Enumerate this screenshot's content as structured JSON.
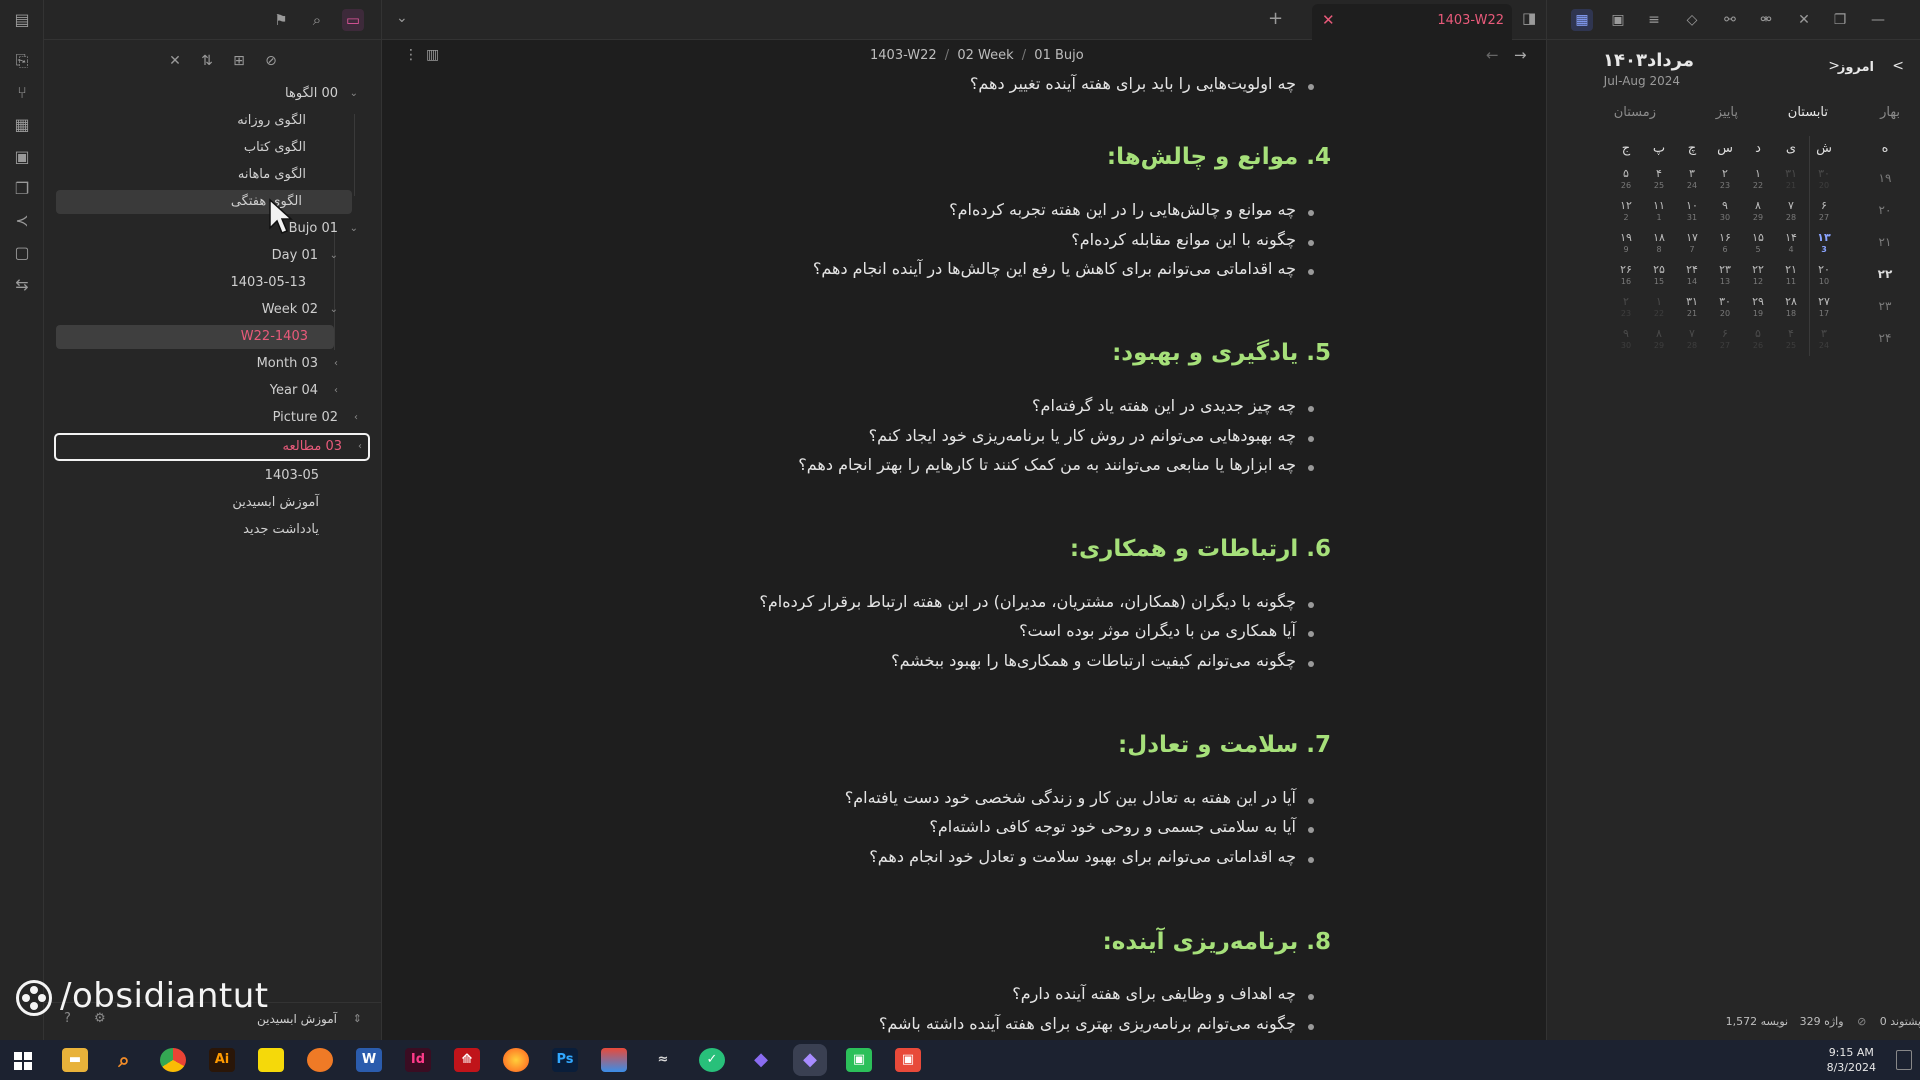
{
  "sidebar": {
    "tree": [
      {
        "label": "00 الگوها",
        "expanded": true
      },
      {
        "label": "الگوی روزانه"
      },
      {
        "label": "الگوی کتاب"
      },
      {
        "label": "الگوی ماهانه"
      },
      {
        "label": "الگوی هفتگی"
      },
      {
        "label": "01 Bujo",
        "expanded": true
      },
      {
        "label": "01 Day",
        "expanded": true
      },
      {
        "label": "1403-05-13"
      },
      {
        "label": "02 Week",
        "expanded": true
      },
      {
        "label": "1403-W22"
      },
      {
        "label": "03 Month"
      },
      {
        "label": "04 Year"
      },
      {
        "label": "02 Picture"
      },
      {
        "label": "03 مطالعه"
      },
      {
        "label": "1403-05"
      },
      {
        "label": "آموزش ابسیدین"
      },
      {
        "label": "یادداشت جدید"
      }
    ],
    "vault_name": "آموزش ابسیدین",
    "watermark": "/obsidiantut"
  },
  "tab": {
    "title": "1403-W22"
  },
  "breadcrumb": {
    "a": "1403-W22",
    "sep1": "/",
    "b": "02 Week",
    "sep2": "/",
    "c": "01 Bujo"
  },
  "note": {
    "top_item": "چه اولویت‌هایی را باید برای هفته آینده تغییر دهم؟",
    "sections": [
      {
        "heading": "4. موانع و چالش‌ها:",
        "items": [
          "چه موانع و چالش‌هایی را در این هفته تجربه کرده‌ام؟",
          "چگونه با این موانع مقابله کرده‌ام؟",
          "چه اقداماتی می‌توانم برای کاهش یا رفع این چالش‌ها در آینده انجام دهم؟"
        ]
      },
      {
        "heading": "5. یادگیری و بهبود:",
        "items": [
          "چه چیز جدیدی در این هفته یاد گرفته‌ام؟",
          "چه بهبودهایی می‌توانم در روش کار یا برنامه‌ریزی خود ایجاد کنم؟",
          "چه ابزارها یا منابعی می‌توانند به من کمک کنند تا کارهایم را بهتر انجام دهم؟"
        ]
      },
      {
        "heading": "6. ارتباطات و همکاری:",
        "items": [
          "چگونه با دیگران (همکاران، مشتریان، مدیران) در این هفته ارتباط برقرار کرده‌ام؟",
          "آیا همکاری من با دیگران موثر بوده است؟",
          "چگونه می‌توانم کیفیت ارتباطات و همکاری‌ها را بهبود ببخشم؟"
        ]
      },
      {
        "heading": "7. سلامت و تعادل:",
        "items": [
          "آیا در این هفته به تعادل بین کار و زندگی شخصی خود دست یافته‌ام؟",
          "آیا به سلامتی جسمی و روحی خود توجه کافی داشته‌ام؟",
          "چه اقداماتی می‌توانم برای بهبود سلامت و تعادل خود انجام دهم؟"
        ]
      },
      {
        "heading": "8. برنامه‌ریزی آینده:",
        "items": [
          "چه اهداف و وظایفی برای هفته آینده دارم؟",
          "چگونه می‌توانم برنامه‌ریزی بهتری برای هفته آینده داشته باشم؟"
        ]
      }
    ]
  },
  "calendar": {
    "title": "۱۴۰۳مرداد",
    "subtitle": "Jul-Aug 2024",
    "today_label": "امروز",
    "prev": "<",
    "next": ">",
    "seasons": [
      "بهار",
      "تابستان",
      "پاییز",
      "زمستان"
    ],
    "weekdays": [
      "ش",
      "ی",
      "د",
      "س",
      "چ",
      "پ",
      "ج"
    ],
    "week_header": "ه",
    "weeks": [
      {
        "num": "۱۹",
        "days": [
          [
            "۳۰",
            "20"
          ],
          [
            "۳۱",
            "21"
          ],
          [
            "۱",
            "22"
          ],
          [
            "۲",
            "23"
          ],
          [
            "۳",
            "24"
          ],
          [
            "۴",
            "25"
          ],
          [
            "۵",
            "26"
          ]
        ]
      },
      {
        "num": "۲۰",
        "days": [
          [
            "۶",
            "27"
          ],
          [
            "۷",
            "28"
          ],
          [
            "۸",
            "29"
          ],
          [
            "۹",
            "30"
          ],
          [
            "۱۰",
            "31"
          ],
          [
            "۱۱",
            "1"
          ],
          [
            "۱۲",
            "2"
          ]
        ]
      },
      {
        "num": "۲۱",
        "days": [
          [
            "۱۳",
            "3"
          ],
          [
            "۱۴",
            "4"
          ],
          [
            "۱۵",
            "5"
          ],
          [
            "۱۶",
            "6"
          ],
          [
            "۱۷",
            "7"
          ],
          [
            "۱۸",
            "8"
          ],
          [
            "۱۹",
            "9"
          ]
        ]
      },
      {
        "num": "۲۲",
        "days": [
          [
            "۲۰",
            "10"
          ],
          [
            "۲۱",
            "11"
          ],
          [
            "۲۲",
            "12"
          ],
          [
            "۲۳",
            "13"
          ],
          [
            "۲۴",
            "14"
          ],
          [
            "۲۵",
            "15"
          ],
          [
            "۲۶",
            "16"
          ]
        ]
      },
      {
        "num": "۲۳",
        "days": [
          [
            "۲۷",
            "17"
          ],
          [
            "۲۸",
            "18"
          ],
          [
            "۲۹",
            "19"
          ],
          [
            "۳۰",
            "20"
          ],
          [
            "۳۱",
            "21"
          ],
          [
            "۱",
            "22"
          ],
          [
            "۲",
            "23"
          ]
        ]
      },
      {
        "num": "۲۴",
        "days": [
          [
            "۳",
            "24"
          ],
          [
            "۴",
            "25"
          ],
          [
            "۵",
            "26"
          ],
          [
            "۶",
            "27"
          ],
          [
            "۷",
            "28"
          ],
          [
            "۸",
            "29"
          ],
          [
            "۹",
            "30"
          ]
        ]
      }
    ]
  },
  "status": {
    "backlinks": "پشتوند 0",
    "words": "واژه 329",
    "chars": "نویسه 1,572"
  },
  "taskbar": {
    "time": "9:15 AM",
    "date": "8/3/2024",
    "apps": [
      "Ai",
      "Id",
      "Ps",
      "W"
    ]
  },
  "colors": {
    "accent": "#e85a7a",
    "heading": "#a6e07a",
    "bg": "#1e1e1e"
  }
}
